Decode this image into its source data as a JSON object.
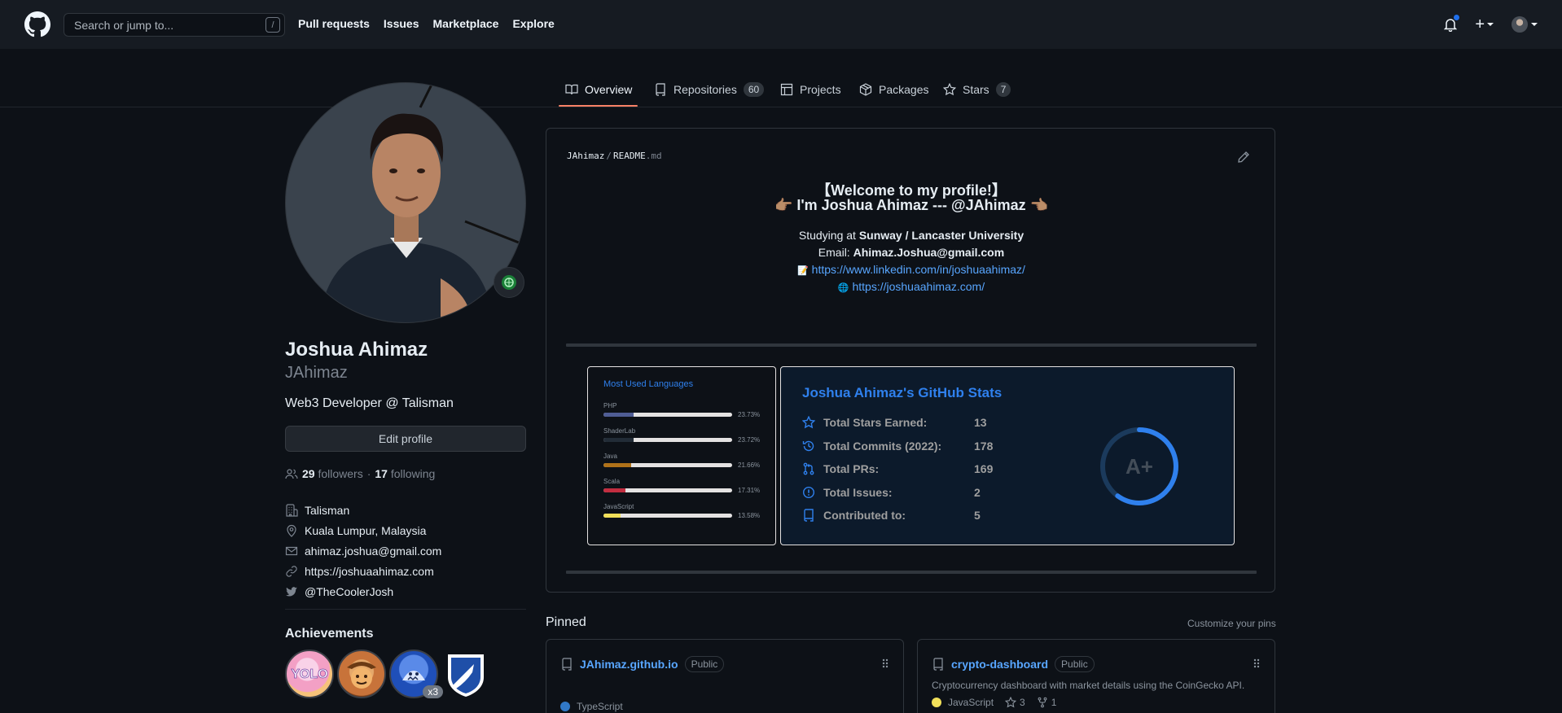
{
  "header": {
    "search_placeholder": "Search or jump to...",
    "search_shortcut": "/",
    "nav": [
      "Pull requests",
      "Issues",
      "Marketplace",
      "Explore"
    ],
    "plus_label": "+"
  },
  "tabs": [
    {
      "label": "Overview",
      "count": null,
      "icon": "book-icon"
    },
    {
      "label": "Repositories",
      "count": "60",
      "icon": "repo-icon"
    },
    {
      "label": "Projects",
      "count": null,
      "icon": "table-icon"
    },
    {
      "label": "Packages",
      "count": null,
      "icon": "package-icon"
    },
    {
      "label": "Stars",
      "count": "7",
      "icon": "star-icon"
    }
  ],
  "profile": {
    "full_name": "Joshua Ahimaz",
    "username": "JAhimaz",
    "bio": "Web3 Developer @ Talisman",
    "edit_label": "Edit profile",
    "followers_count": "29",
    "followers_label": "followers",
    "separator": "·",
    "following_count": "17",
    "following_label": "following",
    "company": "Talisman",
    "location": "Kuala Lumpur, Malaysia",
    "email": "ahimaz.joshua@gmail.com",
    "website": "https://joshuaahimaz.com",
    "twitter": "@TheCoolerJosh",
    "achievements_title": "Achievements",
    "achievement_multiplier": "x3"
  },
  "readme": {
    "owner": "JAhimaz",
    "sep": "/",
    "file": "README",
    "ext": ".md",
    "welcome": "【Welcome to my profile!】",
    "intro": "👉🏽 I'm Joshua Ahimaz --- @JAhimaz 👈🏽",
    "studying_prefix": "Studying at ",
    "studying_value": "Sunway / Lancaster University",
    "email_prefix": "Email: ",
    "email_value": "Ahimaz.Joshua@gmail.com",
    "linkedin_icon": "📝",
    "linkedin": "https://www.linkedin.com/in/joshuaahimaz/",
    "site_icon": "🌐",
    "site": "https://joshuaahimaz.com/"
  },
  "languages": {
    "title": "Most Used Languages",
    "items": [
      {
        "name": "PHP",
        "percent": "23.73%",
        "value": 23.73,
        "color": "#4F5D95"
      },
      {
        "name": "ShaderLab",
        "percent": "23.72%",
        "value": 23.72,
        "color": "#222c37"
      },
      {
        "name": "Java",
        "percent": "21.66%",
        "value": 21.66,
        "color": "#b07219"
      },
      {
        "name": "Scala",
        "percent": "17.31%",
        "value": 17.31,
        "color": "#c22d40"
      },
      {
        "name": "JavaScript",
        "percent": "13.58%",
        "value": 13.58,
        "color": "#f1e05a"
      }
    ]
  },
  "stats": {
    "title": "Joshua Ahimaz's GitHub Stats",
    "rows": [
      {
        "label": "Total Stars Earned:",
        "value": "13",
        "icon": "star-icon"
      },
      {
        "label": "Total Commits (2022):",
        "value": "178",
        "icon": "history-icon"
      },
      {
        "label": "Total PRs:",
        "value": "169",
        "icon": "pull-request-icon"
      },
      {
        "label": "Total Issues:",
        "value": "2",
        "icon": "issue-icon"
      },
      {
        "label": "Contributed to:",
        "value": "5",
        "icon": "repo-icon"
      }
    ],
    "grade": "A+",
    "grade_progress": 0.6
  },
  "pinned": {
    "title": "Pinned",
    "customize": "Customize your pins",
    "repos": [
      {
        "name": "JAhimaz.github.io",
        "visibility": "Public",
        "description": "",
        "language": "TypeScript",
        "lang_color": "#3178c6",
        "stars": "",
        "forks": ""
      },
      {
        "name": "crypto-dashboard",
        "visibility": "Public",
        "description": "Cryptocurrency dashboard with market details using the CoinGecko API.",
        "language": "JavaScript",
        "lang_color": "#f1e05a",
        "stars": "3",
        "forks": "1"
      }
    ]
  },
  "colors": {
    "accent": "#58a6ff",
    "tab_underline": "#f78166",
    "card_title": "#2f80ed"
  }
}
